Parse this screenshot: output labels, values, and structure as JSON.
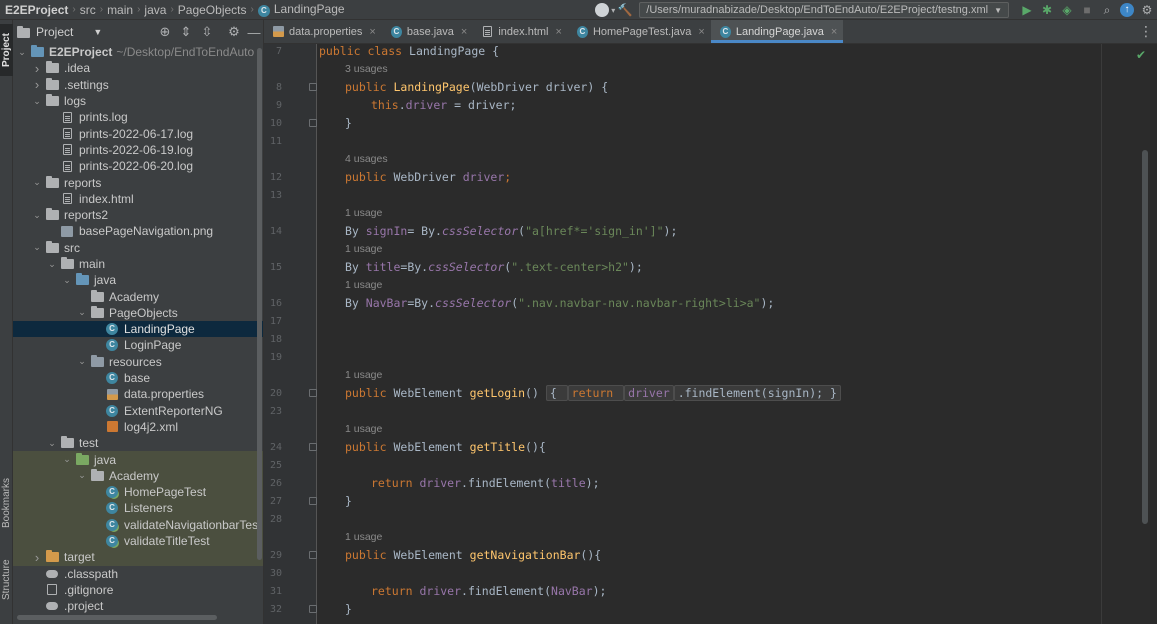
{
  "breadcrumb": [
    "E2EProject",
    "src",
    "main",
    "java",
    "PageObjects",
    "LandingPage"
  ],
  "toolbar": {
    "run_config": "/Users/muradnabizade/Desktop/EndToEndAuto/E2EProject/testng.xml"
  },
  "left_stripe": {
    "project": "Project",
    "bookmarks": "Bookmarks",
    "structure": "Structure"
  },
  "project_panel": {
    "title": "Project",
    "tree": [
      {
        "label": "E2EProject",
        "hint": "~/Desktop/EndToEndAuto",
        "indent": 0,
        "arrow": "down",
        "icon": "folder-blue",
        "bold": true
      },
      {
        "label": ".idea",
        "indent": 1,
        "arrow": "right",
        "icon": "folder"
      },
      {
        "label": ".settings",
        "indent": 1,
        "arrow": "right",
        "icon": "folder"
      },
      {
        "label": "logs",
        "indent": 1,
        "arrow": "down",
        "icon": "folder"
      },
      {
        "label": "prints.log",
        "indent": 2,
        "icon": "file"
      },
      {
        "label": "prints-2022-06-17.log",
        "indent": 2,
        "icon": "file"
      },
      {
        "label": "prints-2022-06-19.log",
        "indent": 2,
        "icon": "file"
      },
      {
        "label": "prints-2022-06-20.log",
        "indent": 2,
        "icon": "file"
      },
      {
        "label": "reports",
        "indent": 1,
        "arrow": "down",
        "icon": "folder"
      },
      {
        "label": "index.html",
        "indent": 2,
        "icon": "file"
      },
      {
        "label": "reports2",
        "indent": 1,
        "arrow": "down",
        "icon": "folder"
      },
      {
        "label": "basePageNavigation.png",
        "indent": 2,
        "icon": "image"
      },
      {
        "label": "src",
        "indent": 1,
        "arrow": "down",
        "icon": "folder"
      },
      {
        "label": "main",
        "indent": 2,
        "arrow": "down",
        "icon": "folder"
      },
      {
        "label": "java",
        "indent": 3,
        "arrow": "down",
        "icon": "folder-blue"
      },
      {
        "label": "Academy",
        "indent": 4,
        "icon": "package"
      },
      {
        "label": "PageObjects",
        "indent": 4,
        "arrow": "down",
        "icon": "package"
      },
      {
        "label": "LandingPage",
        "indent": 5,
        "icon": "class",
        "selected": true
      },
      {
        "label": "LoginPage",
        "indent": 5,
        "icon": "class"
      },
      {
        "label": "resources",
        "indent": 4,
        "arrow": "down",
        "icon": "folder-res"
      },
      {
        "label": "base",
        "indent": 5,
        "icon": "class"
      },
      {
        "label": "data.properties",
        "indent": 5,
        "icon": "props"
      },
      {
        "label": "ExtentReporterNG",
        "indent": 5,
        "icon": "class"
      },
      {
        "label": "log4j2.xml",
        "indent": 5,
        "icon": "xml"
      },
      {
        "label": "test",
        "indent": 2,
        "arrow": "down",
        "icon": "folder"
      },
      {
        "label": "java",
        "indent": 3,
        "arrow": "down",
        "icon": "folder-green",
        "test": true
      },
      {
        "label": "Academy",
        "indent": 4,
        "arrow": "down",
        "icon": "package",
        "test": true
      },
      {
        "label": "HomePageTest",
        "indent": 5,
        "icon": "class-test",
        "test": true
      },
      {
        "label": "Listeners",
        "indent": 5,
        "icon": "class",
        "test": true
      },
      {
        "label": "validateNavigationbarTest",
        "indent": 5,
        "icon": "class-test",
        "test": true
      },
      {
        "label": "validateTitleTest",
        "indent": 5,
        "icon": "class-test",
        "test": true
      },
      {
        "label": "target",
        "indent": 1,
        "arrow": "right",
        "icon": "folder-orange",
        "test": true
      },
      {
        "label": ".classpath",
        "indent": 1,
        "icon": "classpath"
      },
      {
        "label": ".gitignore",
        "indent": 1,
        "icon": "gitignore"
      },
      {
        "label": ".project",
        "indent": 1,
        "icon": "classpath"
      }
    ]
  },
  "tabs": [
    {
      "label": "data.properties",
      "icon": "props"
    },
    {
      "label": "base.java",
      "icon": "class"
    },
    {
      "label": "index.html",
      "icon": "html"
    },
    {
      "label": "HomePageTest.java",
      "icon": "class"
    },
    {
      "label": "LandingPage.java",
      "icon": "class",
      "active": true
    }
  ],
  "editor": {
    "lines": [
      {
        "n": "7",
        "fold": false,
        "code": [
          [
            "kw",
            "public class "
          ],
          [
            "",
            "LandingPage {"
          ]
        ],
        "indent": 0
      },
      {
        "usage": "3 usages",
        "indent": 1
      },
      {
        "n": "8",
        "fold": true,
        "code": [
          [
            "kw",
            "public "
          ],
          [
            "fn",
            "LandingPage"
          ],
          [
            "",
            "(WebDriver driver) {"
          ]
        ],
        "indent": 1
      },
      {
        "n": "9",
        "code": [
          [
            "kw",
            "this"
          ],
          [
            "",
            "."
          ],
          [
            "fld",
            "driver"
          ],
          [
            "",
            " = driver;"
          ]
        ],
        "indent": 2
      },
      {
        "n": "10",
        "fold": true,
        "code": [
          [
            "",
            "}"
          ]
        ],
        "indent": 1
      },
      {
        "n": "11",
        "code": [],
        "indent": 0
      },
      {
        "usage": "4 usages",
        "indent": 1
      },
      {
        "n": "12",
        "code": [
          [
            "kw",
            "public "
          ],
          [
            "",
            "WebDriver "
          ],
          [
            "fld",
            "driver"
          ],
          [
            "kw",
            ";"
          ]
        ],
        "indent": 1
      },
      {
        "n": "13",
        "code": [],
        "indent": 0
      },
      {
        "usage": "1 usage",
        "indent": 1
      },
      {
        "n": "14",
        "code": [
          [
            "",
            "By "
          ],
          [
            "fld",
            "signIn"
          ],
          [
            "",
            "= By."
          ],
          [
            "fld-it",
            "cssSelector"
          ],
          [
            "",
            "("
          ],
          [
            "str",
            "\"a[href*='sign_in']\""
          ],
          [
            "",
            ");"
          ]
        ],
        "indent": 1
      },
      {
        "usage": "1 usage",
        "indent": 1
      },
      {
        "n": "15",
        "code": [
          [
            "",
            "By "
          ],
          [
            "fld",
            "title"
          ],
          [
            "",
            "=By."
          ],
          [
            "fld-it",
            "cssSelector"
          ],
          [
            "",
            "("
          ],
          [
            "str",
            "\".text-center>h2\""
          ],
          [
            "",
            ");"
          ]
        ],
        "indent": 1
      },
      {
        "usage": "1 usage",
        "indent": 1
      },
      {
        "n": "16",
        "code": [
          [
            "",
            "By "
          ],
          [
            "fld",
            "NavBar"
          ],
          [
            "",
            "=By."
          ],
          [
            "fld-it",
            "cssSelector"
          ],
          [
            "",
            "("
          ],
          [
            "str",
            "\".nav.navbar-nav.navbar-right>li>a\""
          ],
          [
            "",
            ");"
          ]
        ],
        "indent": 1
      },
      {
        "n": "17",
        "code": [],
        "indent": 0
      },
      {
        "n": "18",
        "code": [],
        "indent": 0
      },
      {
        "n": "19",
        "code": [],
        "indent": 0
      },
      {
        "usage": "1 usage",
        "indent": 1
      },
      {
        "n": "20",
        "fold": true,
        "code": [
          [
            "kw",
            "public "
          ],
          [
            "",
            "WebElement "
          ],
          [
            "fn",
            "getLogin"
          ],
          [
            "",
            "() "
          ],
          [
            "box",
            "{ "
          ],
          [
            "kw-box",
            "return "
          ],
          [
            "fld-box",
            "driver"
          ],
          [
            "box",
            ".findElement(signIn); }"
          ]
        ],
        "indent": 1
      },
      {
        "n": "23",
        "code": [],
        "indent": 0
      },
      {
        "usage": "1 usage",
        "indent": 1
      },
      {
        "n": "24",
        "fold": true,
        "code": [
          [
            "kw",
            "public "
          ],
          [
            "",
            "WebElement "
          ],
          [
            "fn",
            "getTitle"
          ],
          [
            "",
            "(){"
          ]
        ],
        "indent": 1
      },
      {
        "n": "25",
        "code": [],
        "indent": 0
      },
      {
        "n": "26",
        "code": [
          [
            "kw",
            "return "
          ],
          [
            "fld",
            "driver"
          ],
          [
            "",
            ".findElement("
          ],
          [
            "fld",
            "title"
          ],
          [
            "",
            ");"
          ]
        ],
        "indent": 2
      },
      {
        "n": "27",
        "fold": true,
        "code": [
          [
            "",
            "}"
          ]
        ],
        "indent": 1
      },
      {
        "n": "28",
        "code": [],
        "indent": 0
      },
      {
        "usage": "1 usage",
        "indent": 1
      },
      {
        "n": "29",
        "fold": true,
        "code": [
          [
            "kw",
            "public "
          ],
          [
            "",
            "WebElement "
          ],
          [
            "fn",
            "getNavigationBar"
          ],
          [
            "",
            "(){"
          ]
        ],
        "indent": 1
      },
      {
        "n": "30",
        "code": [],
        "indent": 0
      },
      {
        "n": "31",
        "code": [
          [
            "kw",
            "return "
          ],
          [
            "fld",
            "driver"
          ],
          [
            "",
            ".findElement("
          ],
          [
            "fld",
            "NavBar"
          ],
          [
            "",
            ");"
          ]
        ],
        "indent": 2
      },
      {
        "n": "32",
        "fold": true,
        "code": [
          [
            "",
            "}"
          ]
        ],
        "indent": 1
      }
    ]
  },
  "colors": {
    "keyword": "#cc7832",
    "function": "#ffc66d",
    "field": "#9876aa",
    "string": "#6a8759",
    "text": "#a9b7c6",
    "selection": "#0d293e",
    "accent": "#4a88c7"
  }
}
